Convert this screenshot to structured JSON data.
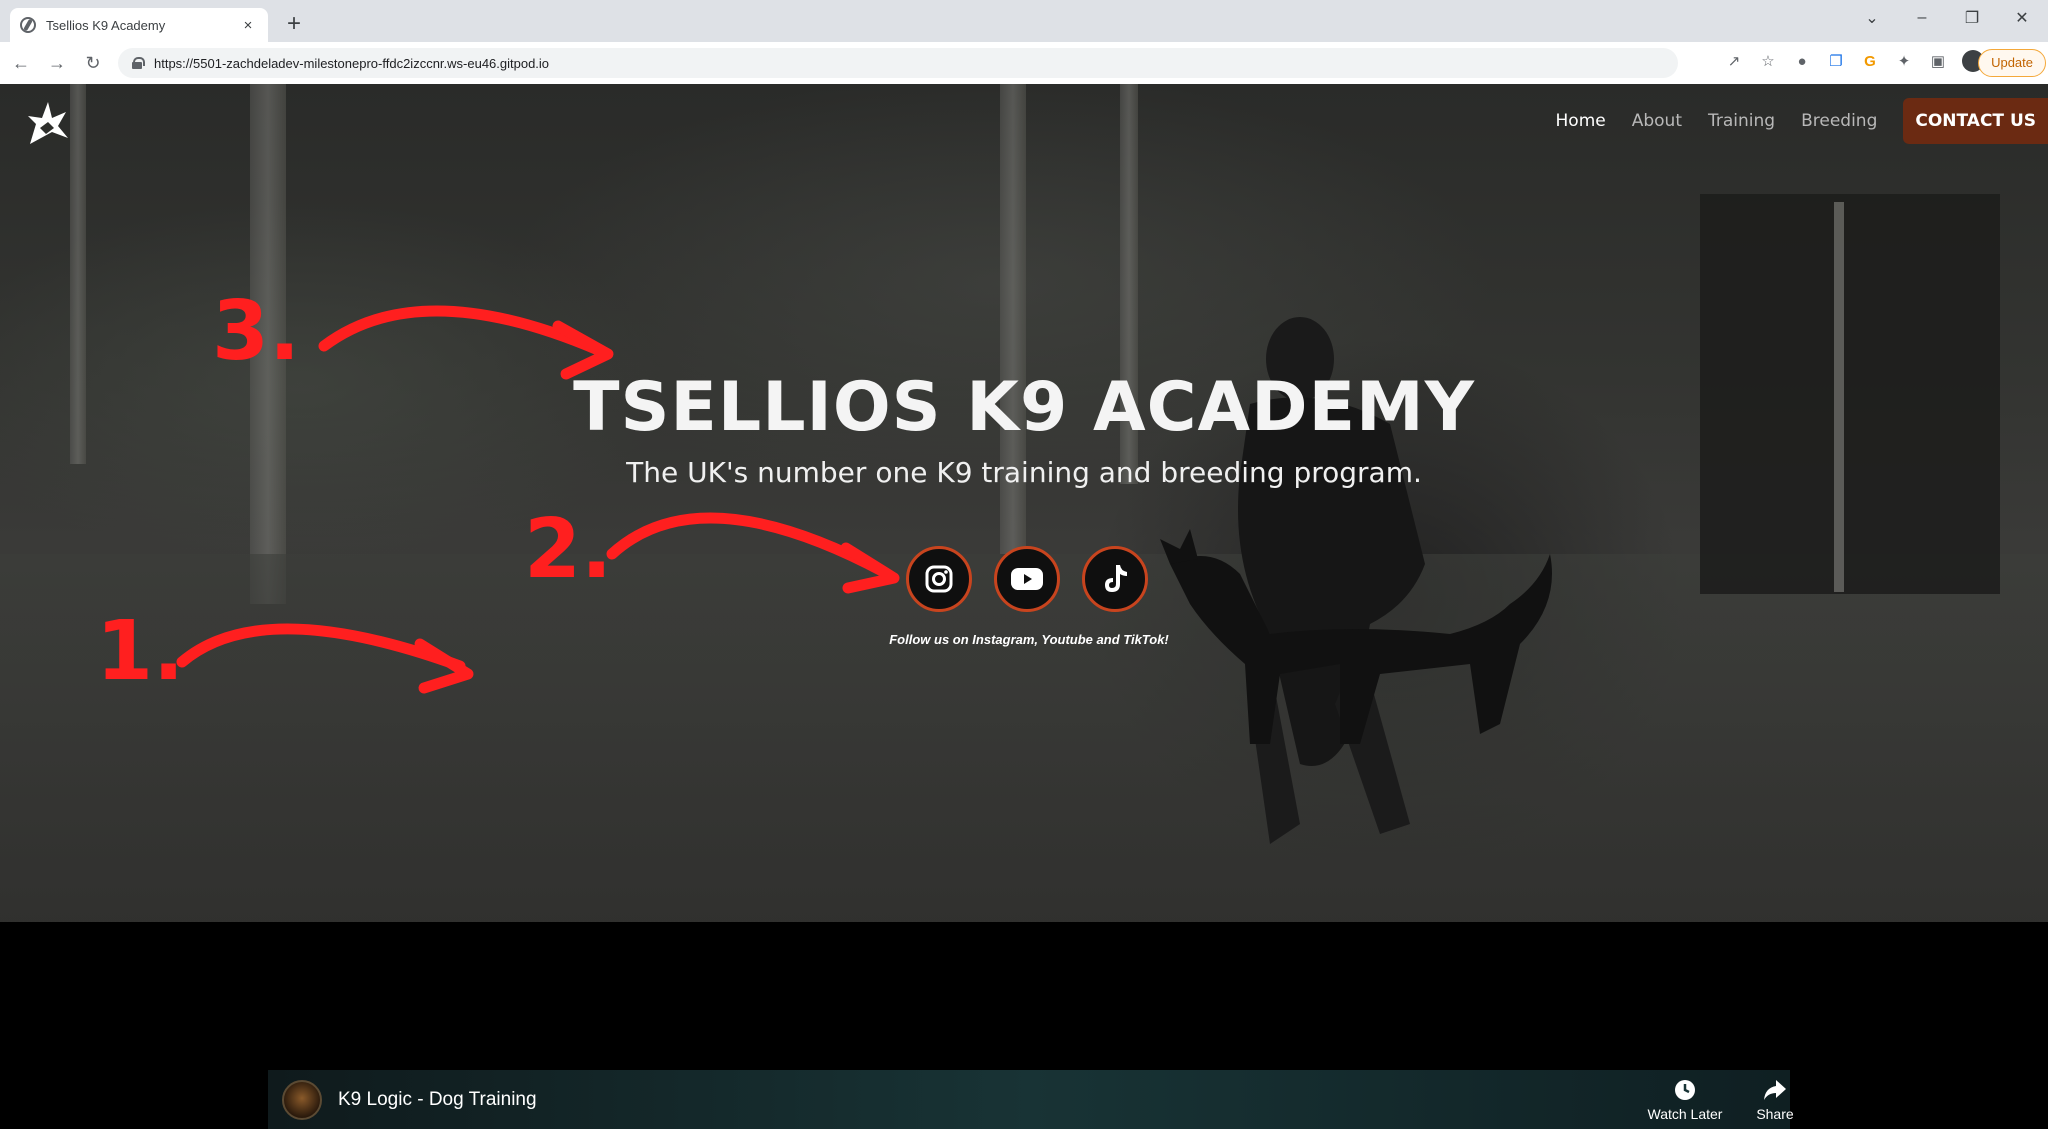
{
  "browser": {
    "tab_title": "Tsellios K9 Academy",
    "tab_close": "×",
    "new_tab": "+",
    "url": "https://5501-zachdeladev-milestonepro-ffdc2izccnr.ws-eu46.gitpod.io",
    "update_label": "Update"
  },
  "site": {
    "nav": {
      "home": "Home",
      "about": "About",
      "training": "Training",
      "breeding": "Breeding",
      "contact": "CONTACT US"
    },
    "title": "TSELLIOS K9 ACADEMY",
    "subtitle": "The UK's number one K9 training and breeding program.",
    "follow_text": "Follow us on Instagram, Youtube and TikTok!",
    "social": [
      "instagram-icon",
      "youtube-icon",
      "tiktok-icon"
    ],
    "accent_color": "#c8441e",
    "contact_bg": "#6b2a12"
  },
  "annotations": {
    "one": "1.",
    "two": "2.",
    "three": "3.",
    "color": "#ff1f1f"
  },
  "video": {
    "channel_title": "K9 Logic - Dog Training",
    "watch_later": "Watch Later",
    "share": "Share"
  }
}
